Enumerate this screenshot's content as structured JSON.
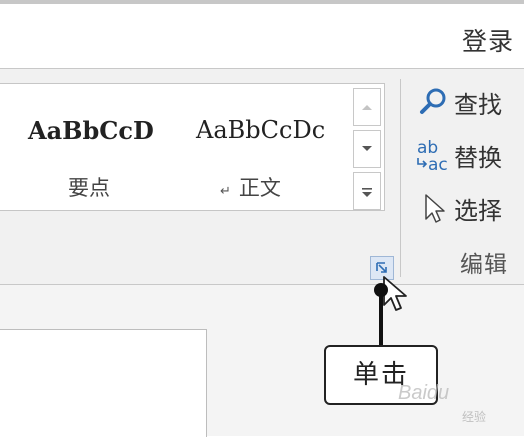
{
  "header": {
    "login_label": "登录"
  },
  "styles_gallery": {
    "items": [
      {
        "sample": "AaBbCcD",
        "name": "要点"
      },
      {
        "sample": "AaBbCcDc",
        "name": "正文",
        "return_mark": "↵"
      }
    ]
  },
  "editing_group": {
    "commands": [
      {
        "label": "查找",
        "icon": "search-icon"
      },
      {
        "label": "替换",
        "icon": "replace-icon"
      },
      {
        "label": "选择",
        "icon": "select-cursor-icon"
      }
    ],
    "group_name": "编辑"
  },
  "annotation": {
    "callout_text": "单击"
  },
  "watermark": {
    "text": "Baidu",
    "sub": "经验"
  },
  "colors": {
    "launcher_fill": "#dde7f5",
    "icon_blue": "#2e6db4"
  }
}
